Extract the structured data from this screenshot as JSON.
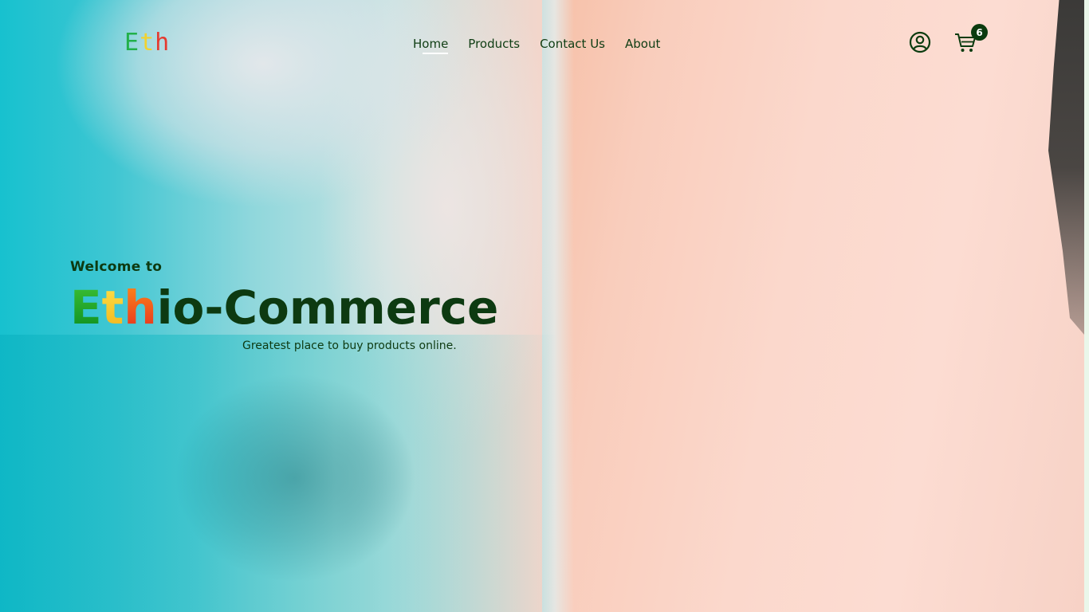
{
  "header": {
    "logo": {
      "letters": [
        "E",
        "t",
        "h"
      ],
      "colors": [
        "#22b04a",
        "#f2d22e",
        "#e53a2f"
      ]
    },
    "nav": [
      {
        "label": "Home",
        "active": true
      },
      {
        "label": "Products",
        "active": false
      },
      {
        "label": "Contact Us",
        "active": false
      },
      {
        "label": "About",
        "active": false
      }
    ],
    "icons": {
      "user": "user-circle-icon",
      "cart": "shopping-cart-icon"
    },
    "cart_count": "6"
  },
  "hero": {
    "welcome": "Welcome to",
    "title_parts": [
      "E",
      "t",
      "h",
      "io-Commerce"
    ],
    "tagline": "Greatest place to buy products online."
  },
  "colors": {
    "text_dark_green": "#0d3a11",
    "badge_bg": "#0b3b0f",
    "sea": "#17c1cf",
    "sand": "#f9cdbc"
  }
}
